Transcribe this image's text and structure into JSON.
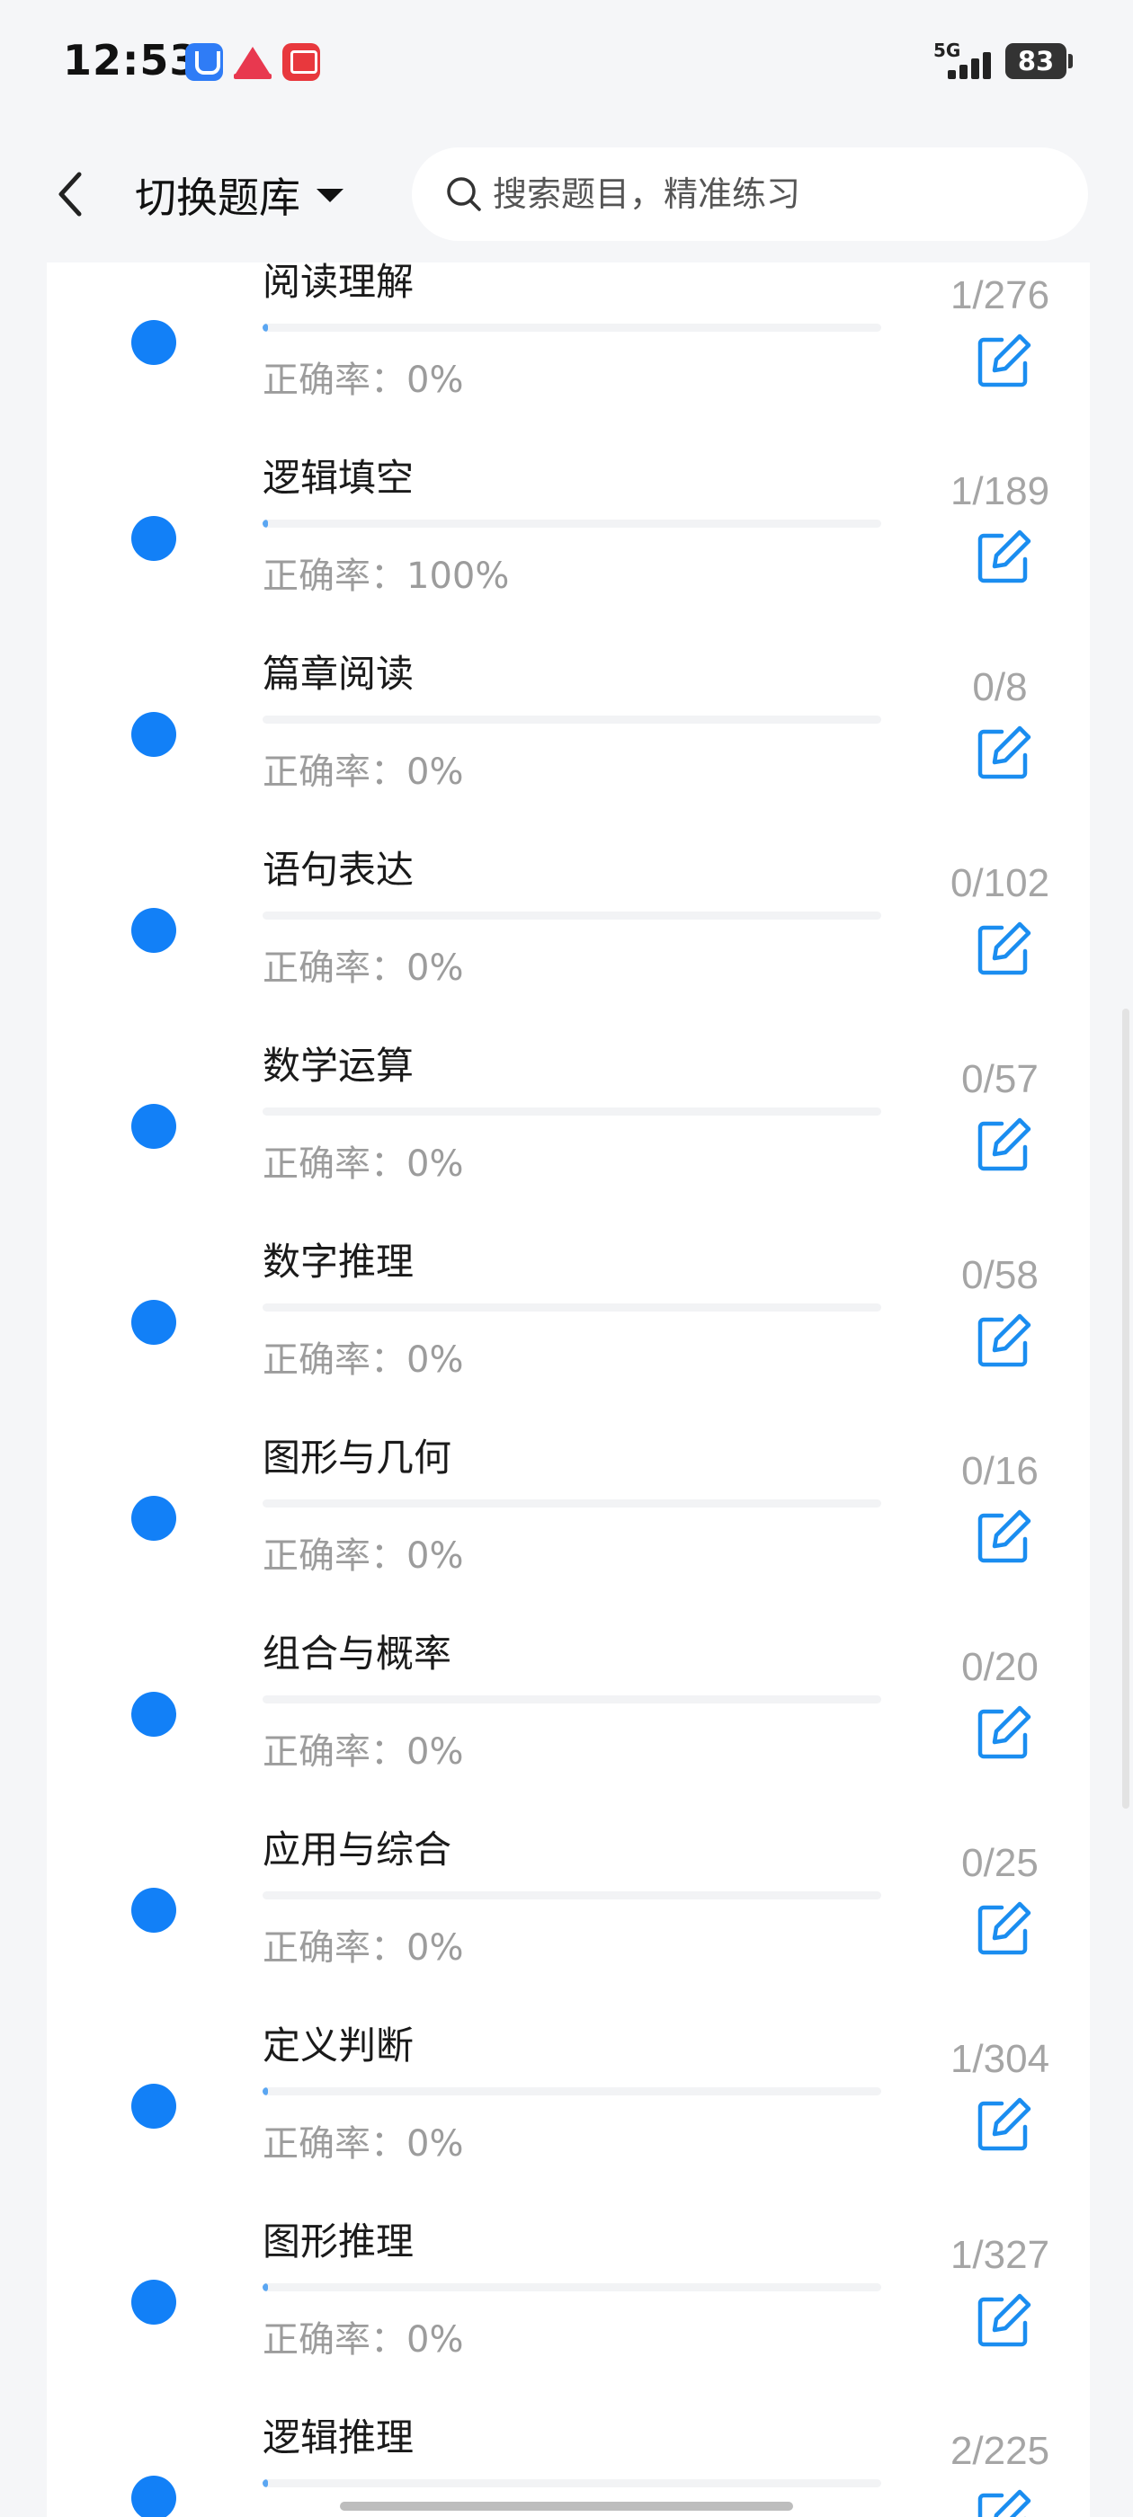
{
  "status_bar": {
    "time": "12:53",
    "network": "5G",
    "battery": "83",
    "notification_icons": [
      "blue-app-icon",
      "red-triangle-app-icon",
      "red-square-app-icon"
    ]
  },
  "nav": {
    "back_icon": "chevron-left-icon",
    "switch_label": "切换题库",
    "search_placeholder": "搜索题目，精准练习"
  },
  "colors": {
    "accent": "#1280f7",
    "progress": "#5aa6f2",
    "edit_icon": "#1a8df0"
  },
  "items": [
    {
      "title": "阅读理解",
      "accuracy": "正确率：0%",
      "count": "1/276",
      "progress": 0.0036
    },
    {
      "title": "逻辑填空",
      "accuracy": "正确率：100%",
      "count": "1/189",
      "progress": 0.0053
    },
    {
      "title": "篇章阅读",
      "accuracy": "正确率：0%",
      "count": "0/8",
      "progress": 0
    },
    {
      "title": "语句表达",
      "accuracy": "正确率：0%",
      "count": "0/102",
      "progress": 0
    },
    {
      "title": "数学运算",
      "accuracy": "正确率：0%",
      "count": "0/57",
      "progress": 0
    },
    {
      "title": "数字推理",
      "accuracy": "正确率：0%",
      "count": "0/58",
      "progress": 0
    },
    {
      "title": "图形与几何",
      "accuracy": "正确率：0%",
      "count": "0/16",
      "progress": 0
    },
    {
      "title": "组合与概率",
      "accuracy": "正确率：0%",
      "count": "0/20",
      "progress": 0
    },
    {
      "title": "应用与综合",
      "accuracy": "正确率：0%",
      "count": "0/25",
      "progress": 0
    },
    {
      "title": "定义判断",
      "accuracy": "正确率：0%",
      "count": "1/304",
      "progress": 0.0033
    },
    {
      "title": "图形推理",
      "accuracy": "正确率：0%",
      "count": "1/327",
      "progress": 0.0031
    },
    {
      "title": "逻辑推理",
      "accuracy": "",
      "count": "2/225",
      "progress": 0.0089
    }
  ]
}
